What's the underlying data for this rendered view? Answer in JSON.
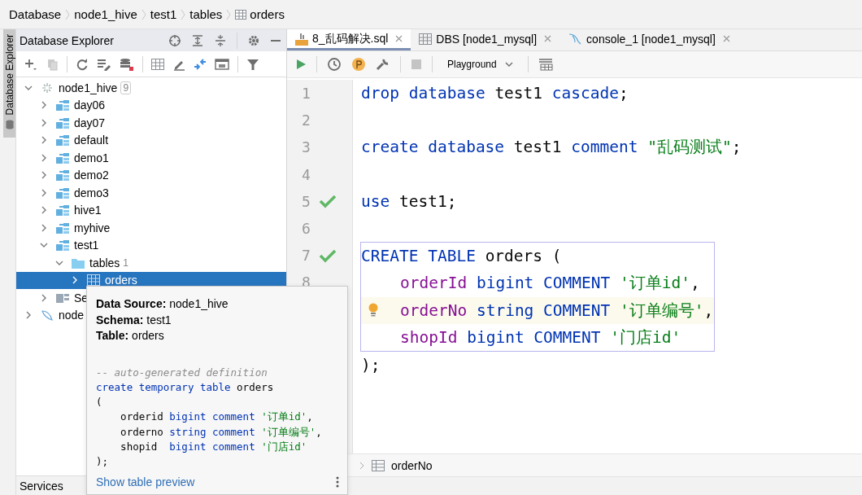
{
  "breadcrumb": [
    {
      "label": "Database",
      "icon": false
    },
    {
      "label": "node1_hive",
      "icon": false
    },
    {
      "label": "test1",
      "icon": false
    },
    {
      "label": "tables",
      "icon": false
    },
    {
      "label": "orders",
      "icon": true
    }
  ],
  "side_strip": {
    "label": "Database Explorer"
  },
  "explorer": {
    "title": "Database Explorer",
    "tree": [
      {
        "label": "node1_hive",
        "kind": "datasource",
        "count": "9",
        "expanded": true,
        "selected": false,
        "children": [
          {
            "label": "day06",
            "kind": "schema",
            "expanded": false,
            "selected": false
          },
          {
            "label": "day07",
            "kind": "schema",
            "expanded": false,
            "selected": false
          },
          {
            "label": "default",
            "kind": "schema",
            "expanded": false,
            "selected": false
          },
          {
            "label": "demo1",
            "kind": "schema",
            "expanded": false,
            "selected": false
          },
          {
            "label": "demo2",
            "kind": "schema",
            "expanded": false,
            "selected": false
          },
          {
            "label": "demo3",
            "kind": "schema",
            "expanded": false,
            "selected": false
          },
          {
            "label": "hive1",
            "kind": "schema",
            "expanded": false,
            "selected": false
          },
          {
            "label": "myhive",
            "kind": "schema",
            "expanded": false,
            "selected": false
          },
          {
            "label": "test1",
            "kind": "schema",
            "expanded": true,
            "selected": false,
            "children": [
              {
                "label": "tables",
                "kind": "folder",
                "count": "1",
                "expanded": true,
                "selected": false,
                "children": [
                  {
                    "label": "orders",
                    "kind": "table",
                    "expanded": false,
                    "selected": true
                  }
                ]
              }
            ]
          },
          {
            "label": "Se",
            "kind": "objects",
            "expanded": false,
            "selected": false
          }
        ]
      },
      {
        "label": "node",
        "kind": "datasource2",
        "expanded": false,
        "selected": false
      }
    ],
    "services": "Services"
  },
  "tabs": [
    {
      "label": "8_乱码解决.sql",
      "kind": "sql",
      "selected": true
    },
    {
      "label": "DBS [node1_mysql]",
      "kind": "table",
      "selected": false
    },
    {
      "label": "console_1 [node1_mysql]",
      "kind": "console",
      "selected": false
    }
  ],
  "toolbar": {
    "schema_mode": "Playground"
  },
  "code": [
    {
      "number": "1",
      "tokens": [
        {
          "text": "drop database ",
          "kind": "keyword"
        },
        {
          "text": "test1 ",
          "kind": "plain"
        },
        {
          "text": "cascade",
          "kind": "keyword"
        },
        {
          "text": ";",
          "kind": "plain"
        }
      ]
    },
    {
      "number": "2"
    },
    {
      "number": "3",
      "tokens": [
        {
          "text": "create database ",
          "kind": "keyword"
        },
        {
          "text": "test1 ",
          "kind": "plain"
        },
        {
          "text": "comment ",
          "kind": "keyword"
        },
        {
          "text": "\"乱码测试\"",
          "kind": "string"
        },
        {
          "text": ";",
          "kind": "plain"
        }
      ]
    },
    {
      "number": "4"
    },
    {
      "number": "5",
      "passed": true,
      "tokens": [
        {
          "text": "use ",
          "kind": "keyword"
        },
        {
          "text": "test1;",
          "kind": "plain"
        }
      ]
    },
    {
      "number": "6"
    },
    {
      "number": "7",
      "passed": true,
      "block": true,
      "tokens": [
        {
          "text": "CREATE TABLE ",
          "kind": "keyword"
        },
        {
          "text": "orders (",
          "kind": "plain"
        }
      ]
    },
    {
      "number": "8",
      "block": true,
      "tokens": [
        {
          "text": "orderId ",
          "kind": "field"
        },
        {
          "text": "bigint COMMENT ",
          "kind": "keyword"
        },
        {
          "text": "'订单id'",
          "kind": "string"
        },
        {
          "text": ",",
          "kind": "plain"
        }
      ]
    },
    {
      "intention": true,
      "current": true,
      "block": true,
      "tokens": [
        {
          "text": "orderNo ",
          "kind": "field"
        },
        {
          "text": "string COMMENT ",
          "kind": "keyword"
        },
        {
          "text": "'订单编号'",
          "kind": "string"
        },
        {
          "text": ",",
          "kind": "plain"
        }
      ]
    },
    {
      "block": true,
      "tokens": [
        {
          "text": "shopId ",
          "kind": "field"
        },
        {
          "text": "bigint COMMENT ",
          "kind": "keyword"
        },
        {
          "text": "'门店id'",
          "kind": "string"
        }
      ]
    },
    {
      "tokens": [
        {
          "text": ");",
          "kind": "plain"
        }
      ]
    }
  ],
  "editor_breadcrumb": "orderNo",
  "tooltip": {
    "info": [
      "**Data Source:** node1_hive",
      "**Schema:** test1",
      "**Table:** orders"
    ],
    "definition": [
      {
        "tokens": [
          {
            "text": "-- auto-generated definition",
            "kind": "comment"
          }
        ]
      },
      {
        "tokens": [
          {
            "text": "create temporary table ",
            "kind": "keyword"
          },
          {
            "text": "orders",
            "kind": "plain"
          }
        ]
      },
      {
        "tokens": [
          {
            "text": "(",
            "kind": "plain"
          }
        ]
      },
      {
        "tokens": [
          {
            "text": "    orderid ",
            "kind": "plain"
          },
          {
            "text": "bigint comment ",
            "kind": "keyword"
          },
          {
            "text": "'订单id'",
            "kind": "string"
          },
          {
            "text": ",",
            "kind": "plain"
          }
        ]
      },
      {
        "tokens": [
          {
            "text": "    orderno ",
            "kind": "plain"
          },
          {
            "text": "string comment ",
            "kind": "keyword"
          },
          {
            "text": "'订单编号'",
            "kind": "string"
          },
          {
            "text": ",",
            "kind": "plain"
          }
        ]
      },
      {
        "tokens": [
          {
            "text": "    shopid  ",
            "kind": "plain"
          },
          {
            "text": "bigint comment ",
            "kind": "keyword"
          },
          {
            "text": "'门店id'",
            "kind": "string"
          }
        ]
      },
      {
        "tokens": [
          {
            "text": ");",
            "kind": "plain"
          }
        ]
      }
    ],
    "link": "Show table preview"
  }
}
